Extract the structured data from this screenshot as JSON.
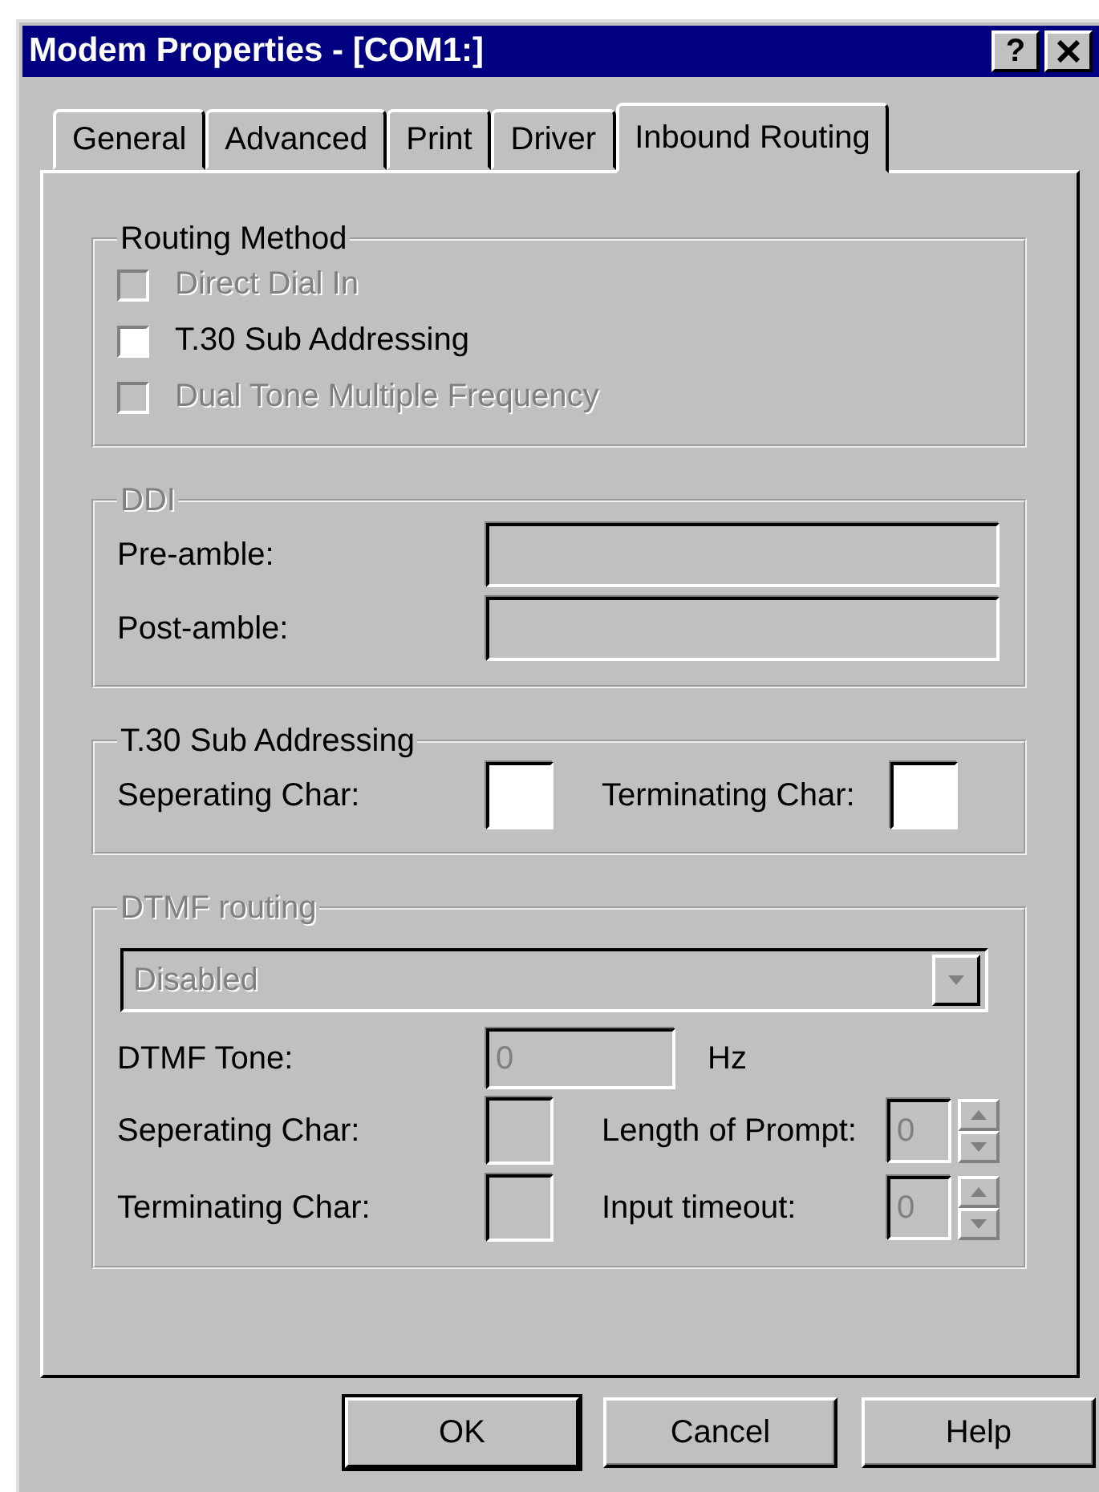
{
  "window": {
    "title": "Modem Properties - [COM1:]",
    "help_button": "?"
  },
  "tabs": [
    {
      "label": "General",
      "selected": false
    },
    {
      "label": "Advanced",
      "selected": false
    },
    {
      "label": "Print",
      "selected": false
    },
    {
      "label": "Driver",
      "selected": false
    },
    {
      "label": "Inbound Routing",
      "selected": true
    }
  ],
  "routing_method": {
    "title": "Routing Method",
    "disabled": false,
    "options": [
      {
        "label": "Direct Dial In",
        "checked": false,
        "disabled": true
      },
      {
        "label": "T.30 Sub Addressing",
        "checked": false,
        "disabled": false
      },
      {
        "label": "Dual Tone Multiple Frequency",
        "checked": false,
        "disabled": true
      }
    ]
  },
  "ddi": {
    "title": "DDI",
    "disabled": true,
    "fields": [
      {
        "label": "Pre-amble:",
        "disabled": true
      },
      {
        "label": "Post-amble:",
        "disabled": true
      }
    ]
  },
  "t30": {
    "title": "T.30 Sub Addressing",
    "disabled": false,
    "fields": [
      {
        "label": "Seperating Char:",
        "disabled": false
      },
      {
        "label": "Terminating Char:",
        "disabled": false
      }
    ]
  },
  "dtmf": {
    "title": "DTMF routing",
    "disabled": true,
    "dropdown": {
      "value": "Disabled",
      "disabled": true
    },
    "tone": {
      "label": "DTMF Tone:",
      "value": "0",
      "unit": "Hz",
      "disabled": true
    },
    "rows": [
      {
        "char_label": "Seperating Char:",
        "char_disabled": true,
        "spin_label": "Length of Prompt:",
        "spin_value": "0",
        "spin_disabled": true
      },
      {
        "char_label": "Terminating Char:",
        "char_disabled": true,
        "spin_label": "Input timeout:",
        "spin_value": "0",
        "spin_disabled": true
      }
    ]
  },
  "buttons": [
    {
      "label": "OK",
      "default": true
    },
    {
      "label": "Cancel",
      "default": false
    },
    {
      "label": "Help",
      "default": false
    }
  ]
}
